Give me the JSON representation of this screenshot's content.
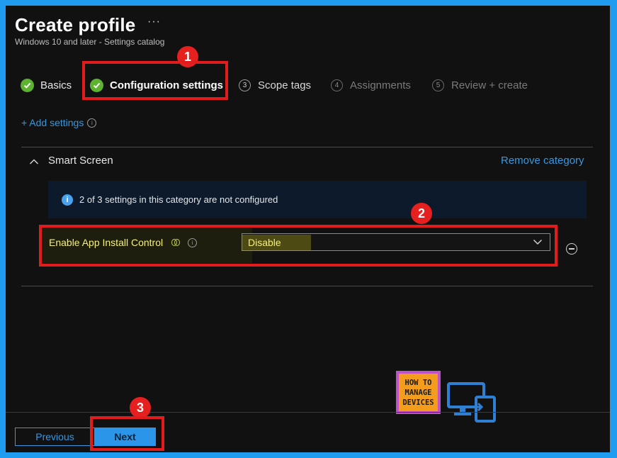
{
  "header": {
    "title": "Create profile",
    "more_label": "···",
    "subtitle": "Windows 10 and later - Settings catalog"
  },
  "steps": [
    {
      "label": "Basics",
      "state": "complete"
    },
    {
      "label": "Configuration settings",
      "state": "current"
    },
    {
      "number": "3",
      "label": "Scope tags",
      "state": "upcoming"
    },
    {
      "number": "4",
      "label": "Assignments",
      "state": "disabled"
    },
    {
      "number": "5",
      "label": "Review + create",
      "state": "disabled"
    }
  ],
  "add_settings": {
    "label": "+ Add settings",
    "info_icon": "i"
  },
  "category": {
    "title": "Smart Screen",
    "remove_label": "Remove category",
    "banner_icon": "i",
    "banner_text": "2 of 3 settings in this category are not configured"
  },
  "setting": {
    "label": "Enable App Install Control",
    "info_icon": "i",
    "value": "Disable"
  },
  "annotations": {
    "one": "1",
    "two": "2",
    "three": "3"
  },
  "footer": {
    "previous_label": "Previous",
    "next_label": "Next"
  },
  "logo": {
    "line1": "HOW TO",
    "line2": "MANAGE",
    "line3": "DEVICES"
  },
  "colors": {
    "accent": "#1f9bf0",
    "link": "#3a96dd",
    "success": "#5db330",
    "annotation_red": "#e11c1c",
    "highlight_yellow": "#f5f07a",
    "primary_button": "#2b95ea"
  }
}
